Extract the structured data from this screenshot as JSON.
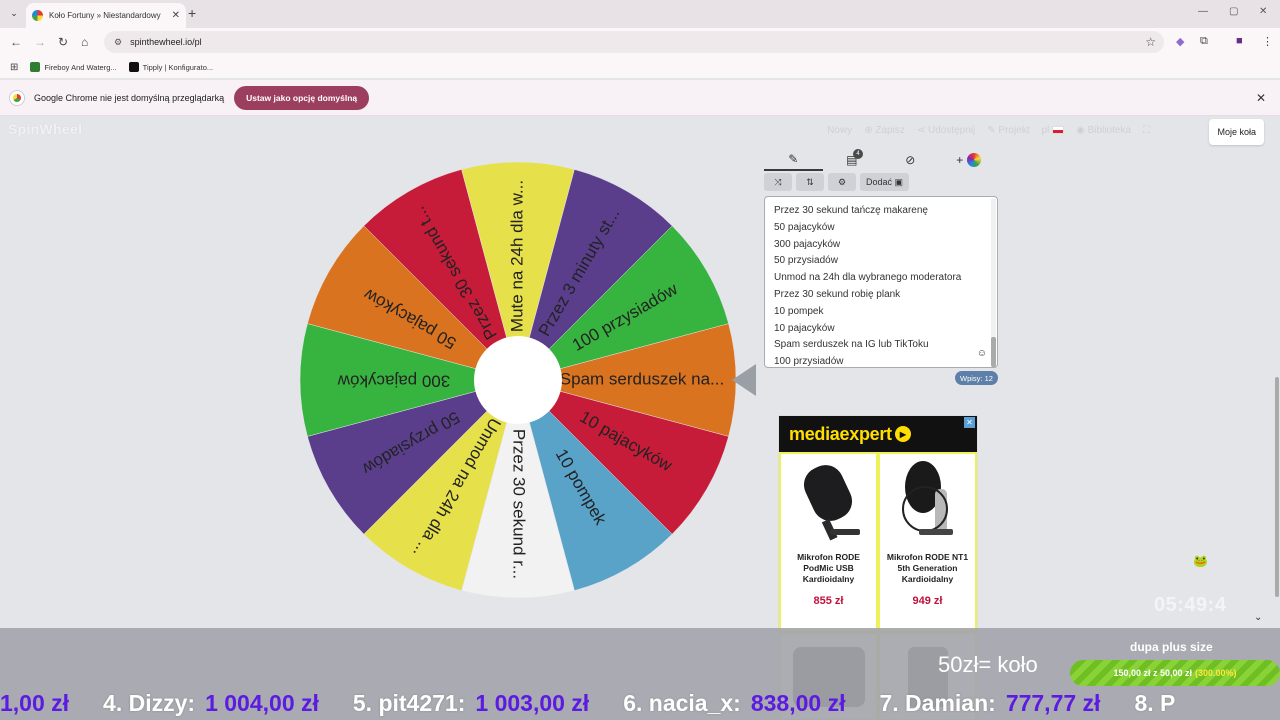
{
  "browser": {
    "tab_title": "Koło Fortuny » Niestandardowy",
    "url": "spinthewheel.io/pl",
    "bookmarks": [
      {
        "label": "Fireboy And Waterg..."
      },
      {
        "label": "Tipply | Konfigurato..."
      }
    ],
    "infobar_text": "Google Chrome nie jest domyślną przeglądarką",
    "infobar_button": "Ustaw jako opcję domyślną"
  },
  "app": {
    "logo": "SpinWheel",
    "nav": [
      "Nowy",
      "Zapisz",
      "Udostępnij",
      "Projekt",
      "pl",
      "Biblioteka"
    ],
    "my_wheels": "Moje koła",
    "add_button": "Dodać",
    "entries": [
      "Przez 30 sekund tańczę makarenę",
      "50 pajacyków",
      "300 pajacyków",
      "50 przysiadów",
      "Unmod na 24h dla wybranego moderatora",
      "Przez 30 sekund robię plank",
      "10 pompek",
      "10 pajacyków",
      "Spam serduszek na IG lub TikToku",
      "100 przysiadów"
    ],
    "entries_count": "Wpisy: 12",
    "wheel_segments": [
      {
        "label": "Spam serduszek na...",
        "color": "#d9731f"
      },
      {
        "label": "10 pajacyków",
        "color": "#c61c3a"
      },
      {
        "label": "10 pompek",
        "color": "#59a3c9"
      },
      {
        "label": "Przez 30 sekund r...",
        "color": "#f2f2f2"
      },
      {
        "label": "Unmod na 24h dla ...",
        "color": "#e6e04a"
      },
      {
        "label": "50 przysiadów",
        "color": "#5a3e8c"
      },
      {
        "label": "300 pajacyków",
        "color": "#37b43f"
      },
      {
        "label": "50 pajacyków",
        "color": "#d9731f"
      },
      {
        "label": "Przez 30 sekund t...",
        "color": "#c61c3a"
      },
      {
        "label": "Mute na 24h dla w...",
        "color": "#e6e04a"
      },
      {
        "label": "Przez 3 minuty st...",
        "color": "#5a3e8c"
      },
      {
        "label": "100 przysiadów",
        "color": "#37b43f"
      }
    ],
    "ad": {
      "brand": "mediaexpert",
      "products": [
        {
          "name": "Mikrofon RODE PodMic USB Kardioidalny",
          "price": "855 zł"
        },
        {
          "name": "Mikrofon RODE NT1 5th Generation Kardioidalny",
          "price": "949 zł"
        }
      ]
    },
    "clock": "05:49:4"
  },
  "overlay": {
    "promo": "50zł= koło",
    "goal_title": "dupa plus size",
    "goal_amount": "150,00 zł z 50,00 zł",
    "goal_percent": "(300.00%)",
    "ticker": [
      {
        "name": "",
        "amount": "1,00 zł"
      },
      {
        "name": "4. Dizzy:",
        "amount": "1 004,00 zł"
      },
      {
        "name": "5. pit4271:",
        "amount": "1 003,00 zł"
      },
      {
        "name": "6. nacia_x:",
        "amount": "838,00 zł"
      },
      {
        "name": "7. Damian:",
        "amount": "777,77 zł"
      },
      {
        "name": "8. P",
        "amount": ""
      }
    ]
  }
}
